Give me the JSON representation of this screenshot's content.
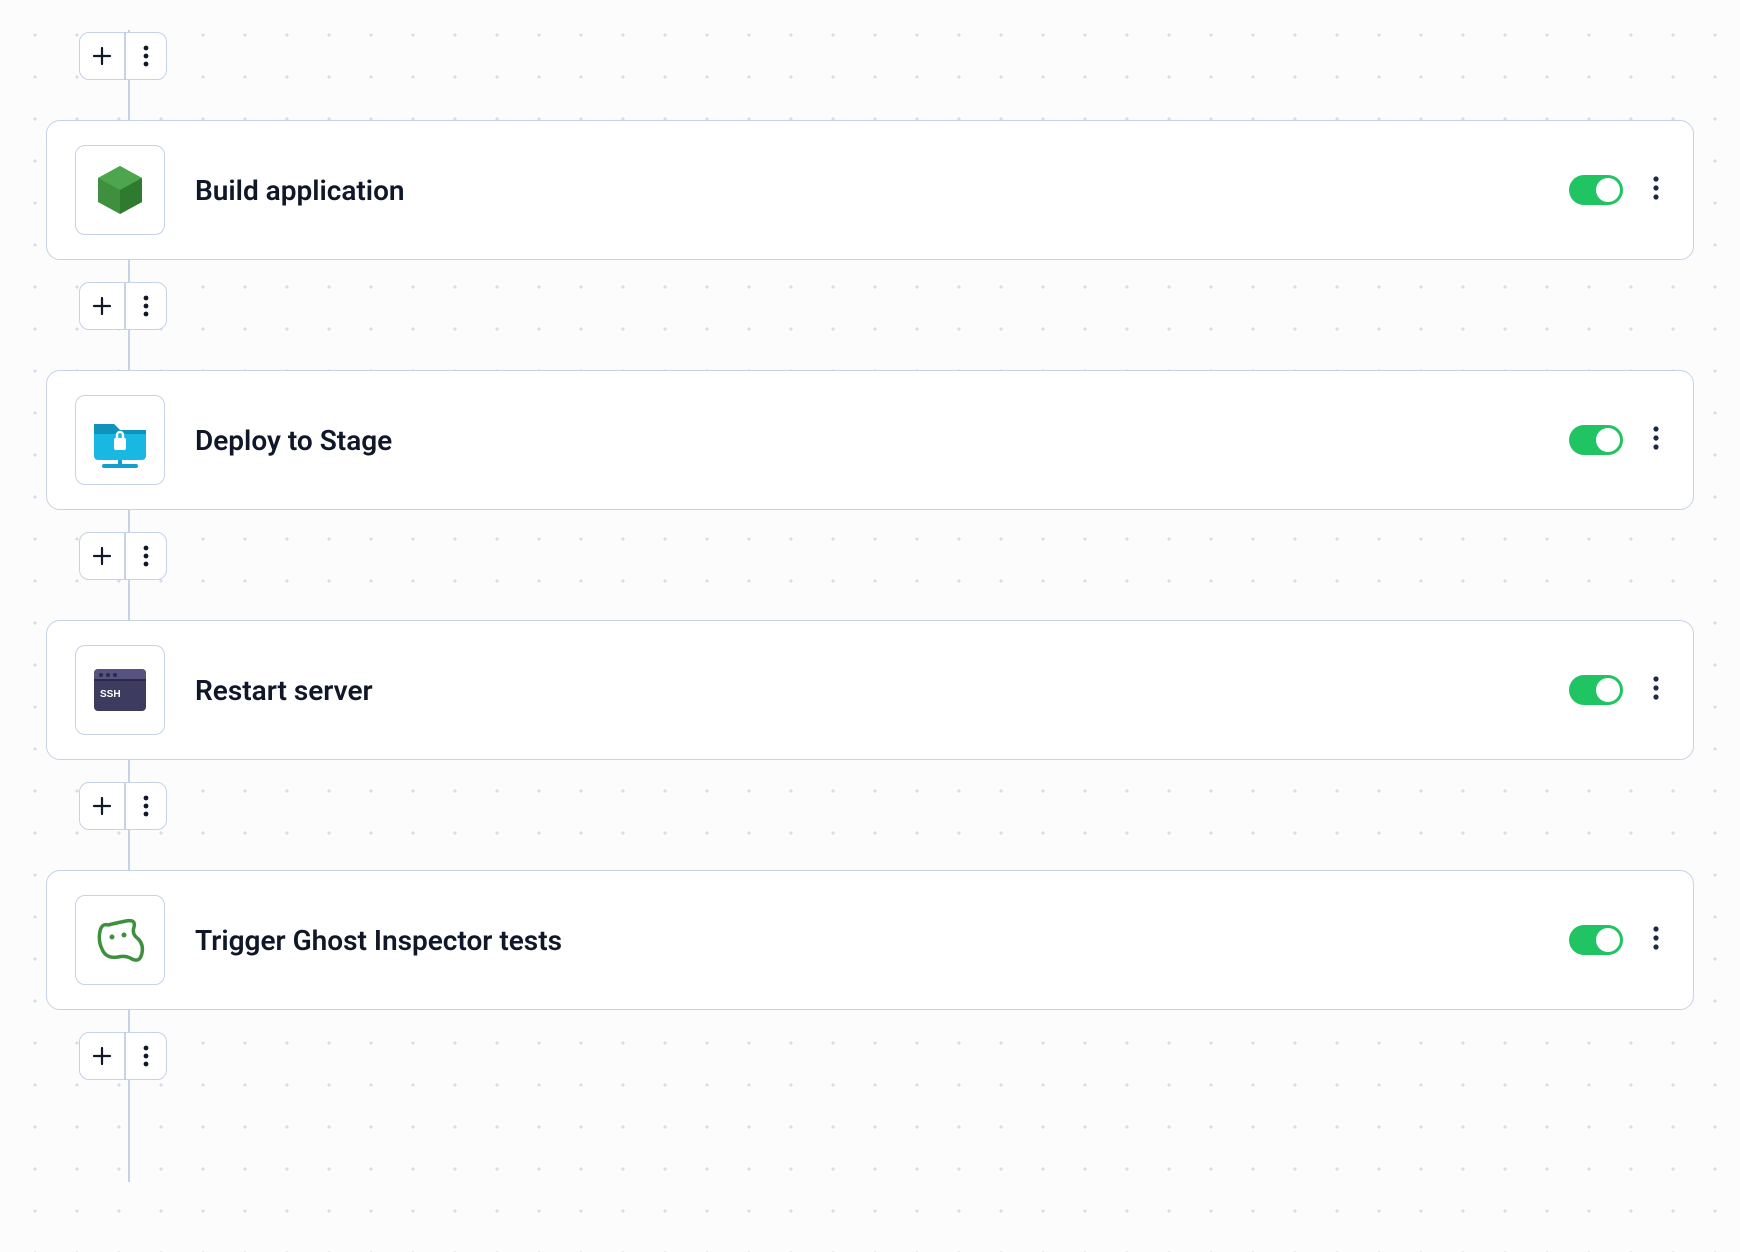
{
  "colors": {
    "border": "#c6d2e6",
    "toggle_on": "#21c463",
    "text": "#0f1729"
  },
  "steps": [
    {
      "title": "Build application",
      "enabled": true,
      "icon": "node-hexagon"
    },
    {
      "title": "Deploy to Stage",
      "enabled": true,
      "icon": "secure-folder"
    },
    {
      "title": "Restart server",
      "enabled": true,
      "icon": "ssh-terminal"
    },
    {
      "title": "Trigger Ghost Inspector tests",
      "enabled": true,
      "icon": "ghost-inspector"
    }
  ]
}
